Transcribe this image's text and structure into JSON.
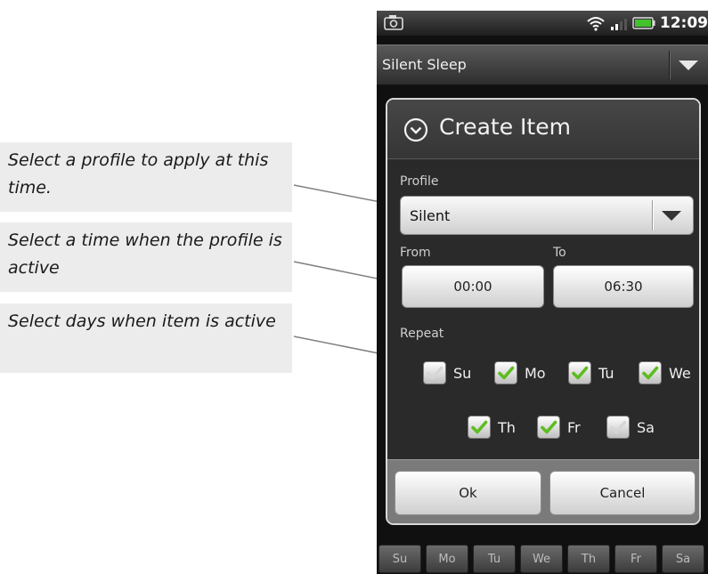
{
  "callouts": [
    "Select a profile to apply at this time.",
    "Select a time when the profile is active",
    "Select days when item is active"
  ],
  "status": {
    "time": "12:09"
  },
  "top_spinner": {
    "value": "Silent Sleep"
  },
  "dialog": {
    "title": "Create Item",
    "profile_label": "Profile",
    "profile_value": "Silent",
    "from_label": "From",
    "to_label": "To",
    "from_value": "00:00",
    "to_value": "06:30",
    "repeat_label": "Repeat",
    "days": [
      {
        "label": "Su",
        "checked": false
      },
      {
        "label": "Mo",
        "checked": true
      },
      {
        "label": "Tu",
        "checked": true
      },
      {
        "label": "We",
        "checked": true
      },
      {
        "label": "Th",
        "checked": true
      },
      {
        "label": "Fr",
        "checked": true
      },
      {
        "label": "Sa",
        "checked": false
      }
    ],
    "ok_label": "Ok",
    "cancel_label": "Cancel"
  },
  "bottom_tabs": [
    "Su",
    "Mo",
    "Tu",
    "We",
    "Th",
    "Fr",
    "Sa"
  ],
  "colors": {
    "check": "#5cbd1f",
    "callout_bg": "#ececec",
    "dialog_bg": "#2a2a2a"
  }
}
